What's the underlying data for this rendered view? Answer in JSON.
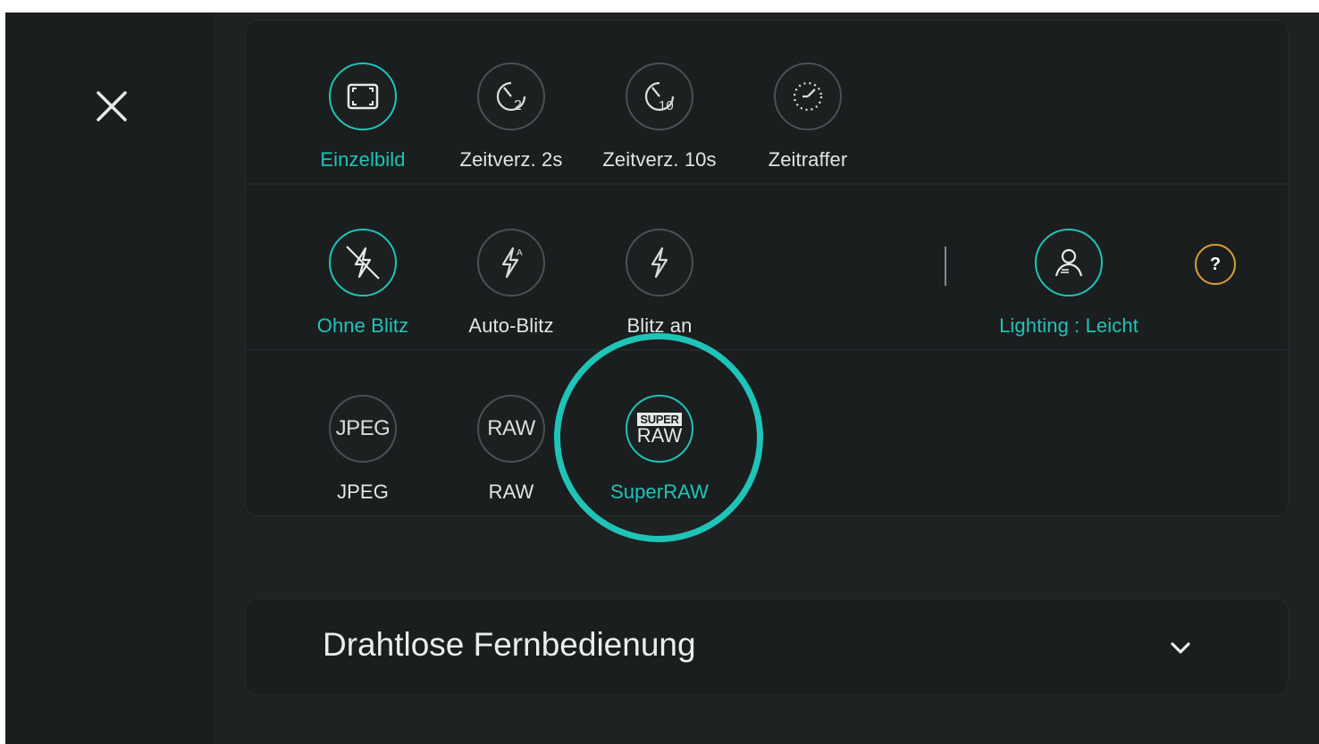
{
  "close": {
    "label": ""
  },
  "drive_modes": [
    {
      "label": "Einzelbild",
      "icon": "frame-icon",
      "active": true
    },
    {
      "label": "Zeitverz. 2s",
      "icon": "timer-2s-icon",
      "active": false
    },
    {
      "label": "Zeitverz. 10s",
      "icon": "timer-10s-icon",
      "active": false
    },
    {
      "label": "Zeitraffer",
      "icon": "timelapse-icon",
      "active": false
    }
  ],
  "flash_modes": [
    {
      "label": "Ohne Blitz",
      "icon": "flash-off-icon",
      "active": true
    },
    {
      "label": "Auto-Blitz",
      "icon": "flash-auto-icon",
      "active": false
    },
    {
      "label": "Blitz an",
      "icon": "flash-on-icon",
      "active": false
    }
  ],
  "lighting": {
    "label": "Lighting : Leicht",
    "icon": "portrait-lighting-icon",
    "active": true
  },
  "help": {
    "label": "?"
  },
  "formats": [
    {
      "label": "JPEG",
      "icon_text": "JPEG",
      "active": false
    },
    {
      "label": "RAW",
      "icon_text": "RAW",
      "active": false
    },
    {
      "label": "SuperRAW",
      "icon_text_top": "SUPER",
      "icon_text_bottom": "RAW",
      "active": true
    }
  ],
  "remote": {
    "title": "Drahtlose Fernbedienung",
    "icon": "chevron-down-icon"
  },
  "colors": {
    "accent": "#1fc4b8",
    "help_ring": "#d89a3b",
    "background": "#1e2223"
  }
}
